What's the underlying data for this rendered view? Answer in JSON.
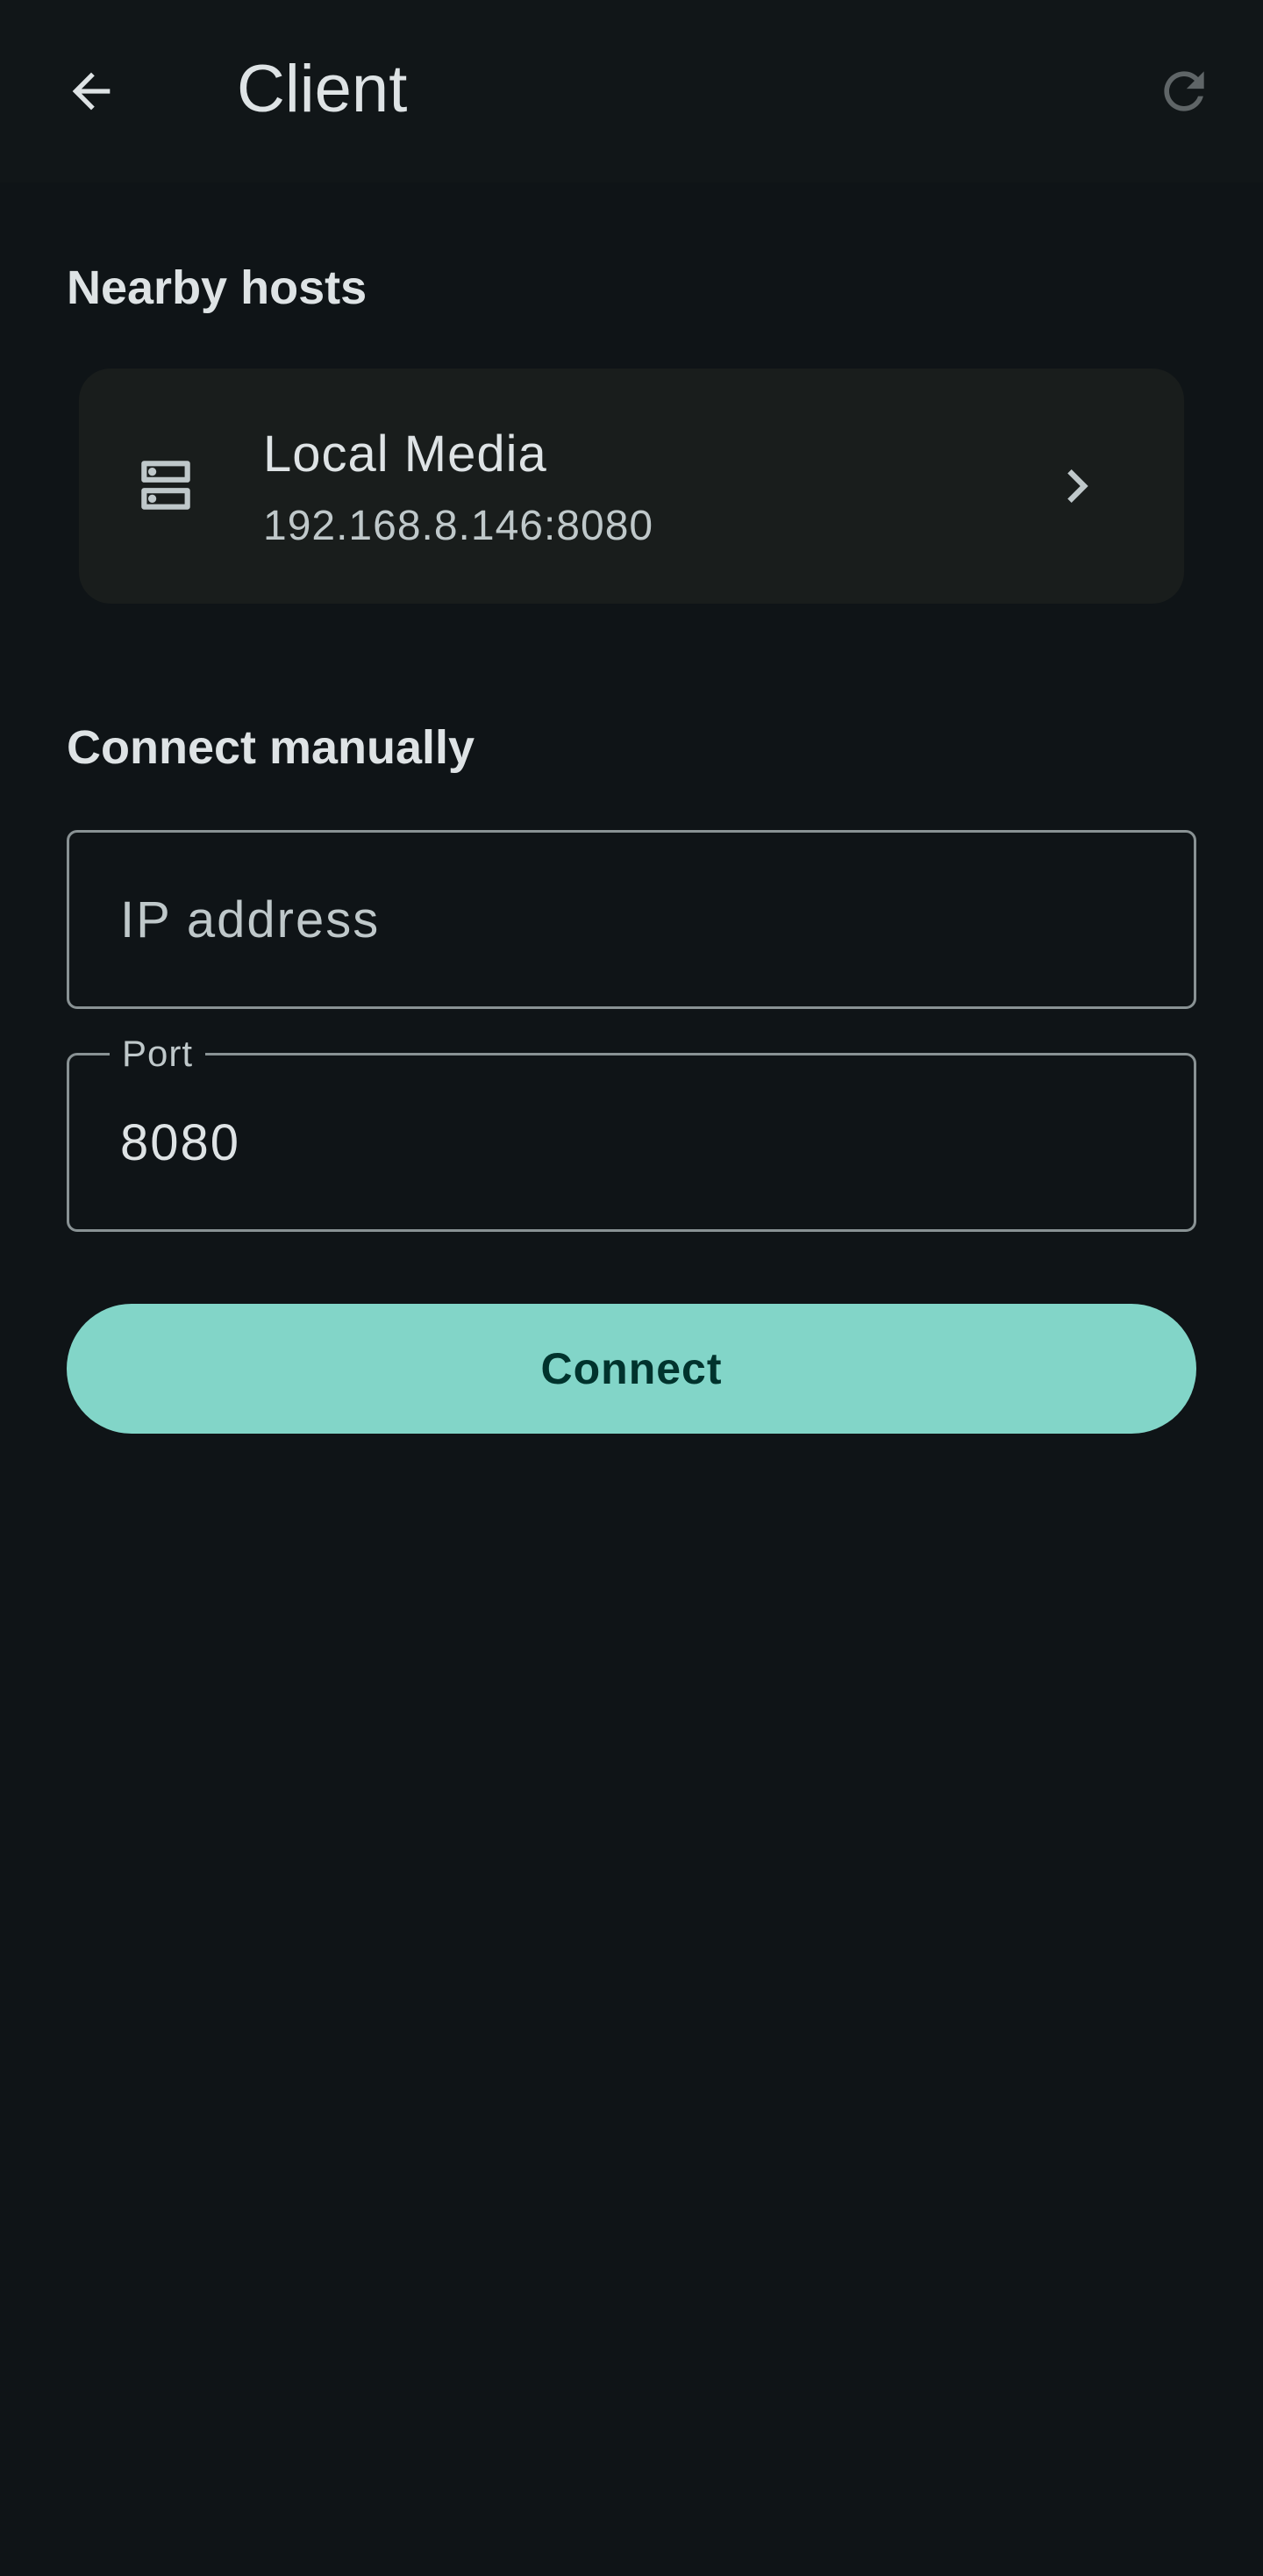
{
  "header": {
    "title": "Client",
    "back_icon": "arrow-back-icon",
    "refresh_icon": "refresh-icon"
  },
  "nearby": {
    "heading": "Nearby hosts",
    "hosts": [
      {
        "name": "Local Media",
        "address": "192.168.8.146:8080",
        "icon": "server-icon",
        "chevron_icon": "chevron-right-icon"
      }
    ]
  },
  "manual": {
    "heading": "Connect manually",
    "ip_field": {
      "placeholder": "IP address",
      "value": ""
    },
    "port_field": {
      "label": "Port",
      "value": "8080"
    },
    "connect_label": "Connect"
  },
  "colors": {
    "background": "#0f1417",
    "card": "#191d1c",
    "accent": "#82d5c8",
    "on_accent": "#00332d",
    "outline": "#899294",
    "text": "#dee3e5",
    "text_secondary": "#bfc8ca"
  }
}
